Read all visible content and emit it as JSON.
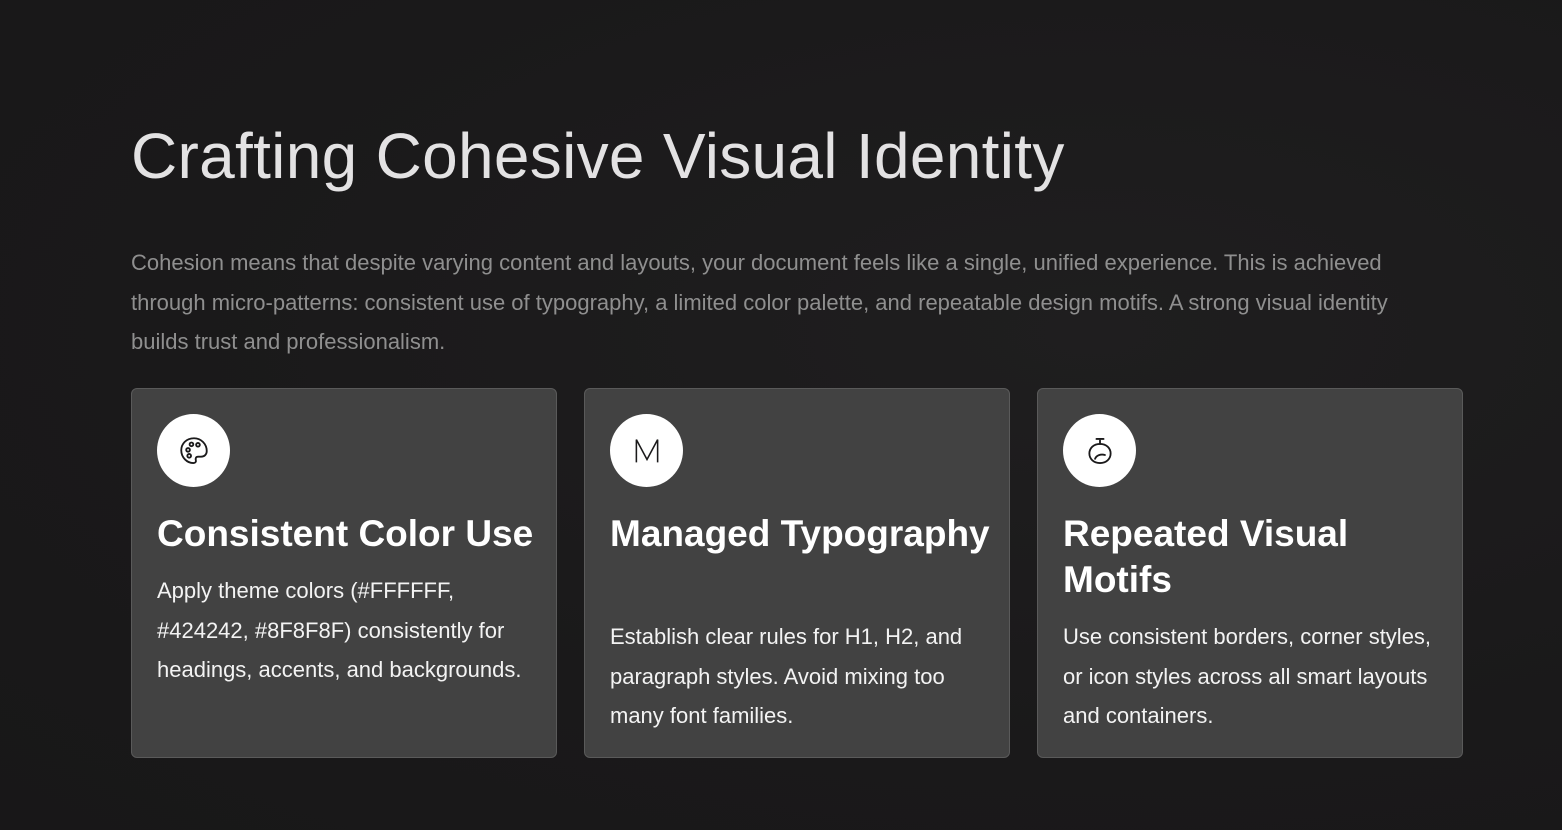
{
  "slide": {
    "title": "Crafting Cohesive Visual Identity",
    "intro": "Cohesion means that despite varying content and layouts, your document feels like a single, unified experience. This is achieved through micro-patterns: consistent use of typography, a limited color palette, and repeatable design motifs. A strong visual identity builds trust and professionalism."
  },
  "cards": [
    {
      "icon": "palette-icon",
      "title": "Consistent Color Use",
      "body": "Apply theme colors (#FFFFFF, #424242, #8F8F8F) consistently for headings, accents, and backgrounds."
    },
    {
      "icon": "letter-m-icon",
      "title": "Managed Typography",
      "body": "Establish clear rules for H1, H2, and paragraph styles. Avoid mixing too many font families."
    },
    {
      "icon": "fruit-icon",
      "title": "Repeated Visual Motifs",
      "body": "Use consistent borders, corner styles, or icon styles across all smart layouts and containers."
    }
  ],
  "colors": {
    "background": "#1b1a1b",
    "card": "#424242",
    "card_border": "#5a5a5a",
    "title": "#e3e2e3",
    "muted_text": "#8f8f8f",
    "white": "#ffffff"
  }
}
